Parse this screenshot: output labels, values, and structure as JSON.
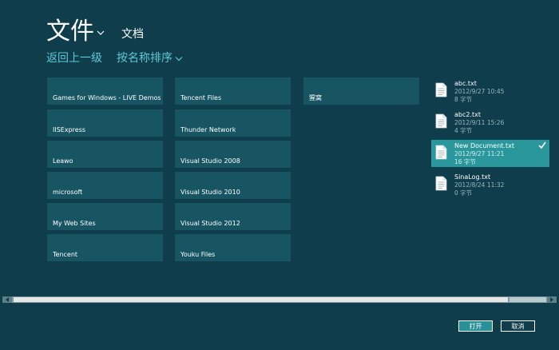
{
  "header": {
    "title": "文件",
    "location": "文档"
  },
  "nav": {
    "back_label": "返回上一级",
    "sort_label": "按名称排序"
  },
  "folders": [
    "Games for Windows - LIVE Demos",
    "IISExpress",
    "Leawo",
    "microsoft",
    "My Web Sites",
    "Tencent",
    "Tencent Files",
    "Thunder Network",
    "Visual Studio 2008",
    "Visual Studio 2010",
    "Visual Studio 2012",
    "Youku Files",
    "猩窝"
  ],
  "files": [
    {
      "name": "abc.txt",
      "date": "2012/9/27 10:45",
      "size": "8 字节",
      "selected": false
    },
    {
      "name": "abc2.txt",
      "date": "2012/9/11 15:26",
      "size": "4 字节",
      "selected": false
    },
    {
      "name": "New Document.txt",
      "date": "2012/9/27 11:21",
      "size": "16 字节",
      "selected": true
    },
    {
      "name": "SinaLog.txt",
      "date": "2012/8/24 11:32",
      "size": "0 字节",
      "selected": false
    }
  ],
  "footer": {
    "open_label": "打开",
    "cancel_label": "取消"
  },
  "colors": {
    "background": "#0f3d4c",
    "tile": "#175563",
    "accent": "#5ec9d6",
    "selected": "#2a979d"
  }
}
